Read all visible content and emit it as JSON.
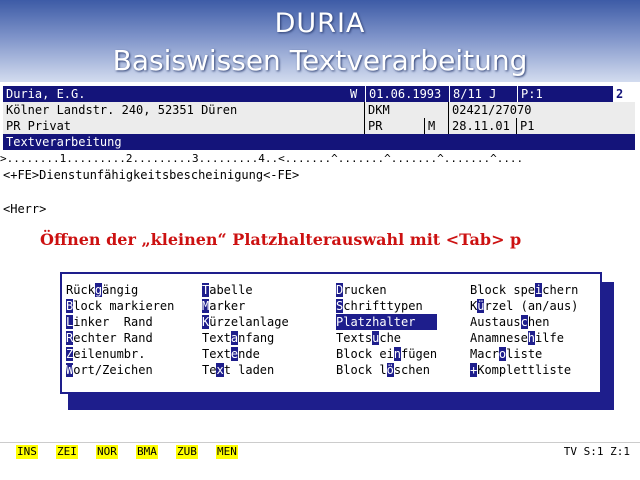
{
  "banner": {
    "title": "DURIA",
    "subtitle": "Basiswissen Textverarbeitung"
  },
  "header": {
    "row1": {
      "name": "Duria, E.G.",
      "flag": "W",
      "date": "01.06.1993",
      "age": "8/11 J",
      "page": "P:1",
      "num": "2"
    },
    "row2": {
      "address": "Kölner Landstr. 240, 52351 Düren",
      "insurer": "DKM",
      "phone": "02421/27070"
    },
    "row3": {
      "status": "PR Privat",
      "code": "PR",
      "sex": "M",
      "visit_date": "28.11.01",
      "p": "P1"
    },
    "section": "Textverarbeitung"
  },
  "ruler": ">........1.........2.........3.........4..<.......^.......^.......^.......^....",
  "document": {
    "line1": "<+FE>Dienstunfähigkeitsbescheinigung<-FE>",
    "line2": "<Herr>"
  },
  "instruction": "Öffnen der „kleinen“ Platzhalterauswahl mit <Tab> p",
  "popup": {
    "selected": "Platzhalter",
    "columns": [
      [
        {
          "pre": "Rück",
          "key": "g",
          "post": "ängig"
        },
        {
          "pre": "",
          "key": "B",
          "post": "lock markieren"
        },
        {
          "pre": "",
          "key": "L",
          "post": "inker  Rand"
        },
        {
          "pre": "",
          "key": "R",
          "post": "echter Rand"
        },
        {
          "pre": "",
          "key": "Z",
          "post": "eilenumbr."
        },
        {
          "pre": "",
          "key": "W",
          "post": "ort/Zeichen"
        }
      ],
      [
        {
          "pre": "",
          "key": "T",
          "post": "abelle"
        },
        {
          "pre": "",
          "key": "M",
          "post": "arker"
        },
        {
          "pre": "",
          "key": "K",
          "post": "ürzelanlage"
        },
        {
          "pre": "Text",
          "key": "a",
          "post": "nfang"
        },
        {
          "pre": "Text",
          "key": "e",
          "post": "nde"
        },
        {
          "pre": "Te",
          "key": "x",
          "post": "t laden"
        }
      ],
      [
        {
          "pre": "",
          "key": "D",
          "post": "rucken"
        },
        {
          "pre": "",
          "key": "S",
          "post": "chrifttypen"
        },
        {
          "pre": "Platzhalter",
          "key": "",
          "post": ""
        },
        {
          "pre": "Texts",
          "key": "u",
          "post": "che"
        },
        {
          "pre": "Block ei",
          "key": "n",
          "post": "fügen"
        },
        {
          "pre": "Block l",
          "key": "ö",
          "post": "schen"
        }
      ],
      [
        {
          "pre": "Block spe",
          "key": "i",
          "post": "chern"
        },
        {
          "pre": "K",
          "key": "ü",
          "post": "rzel (an/aus)"
        },
        {
          "pre": "Austaus",
          "key": "c",
          "post": "hen"
        },
        {
          "pre": "Anamnese",
          "key": "h",
          "post": "ilfe"
        },
        {
          "pre": "Macr",
          "key": "o",
          "post": "liste"
        },
        {
          "pre": "",
          "key": "+",
          "post": "Komplettliste"
        }
      ]
    ]
  },
  "statusbar": {
    "keys": [
      "INS",
      "ZEI",
      "NOR",
      "BMA",
      "ZUB",
      "MEN"
    ],
    "position": "TV S:1 Z:1"
  },
  "colors": {
    "navy": "#14147a",
    "popup_blue": "#1e1e8c",
    "instruction_red": "#cc1111",
    "fkey_yellow": "#ffff00"
  }
}
